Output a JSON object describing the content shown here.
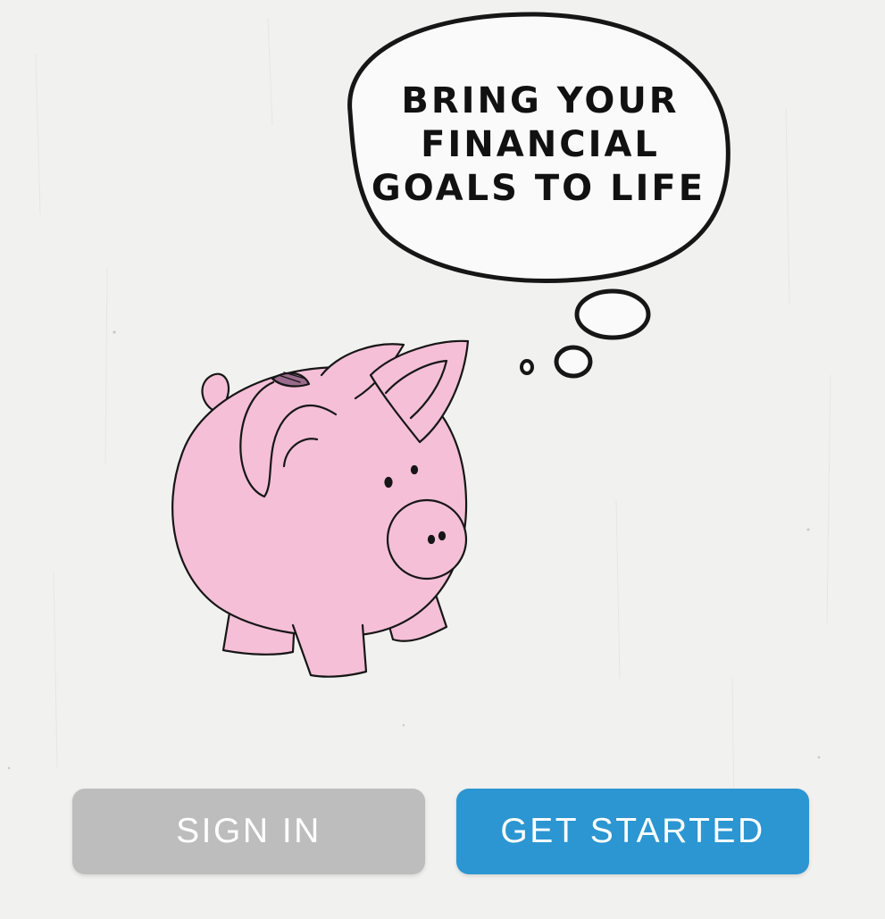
{
  "headline": {
    "line1": "BRING YOUR",
    "line2": "FINANCIAL",
    "line3": "GOALS TO LIFE"
  },
  "illustration": {
    "icon": "piggy-bank",
    "bubble_icon": "thought-bubble"
  },
  "buttons": {
    "sign_in": "SIGN IN",
    "get_started": "GET STARTED"
  },
  "colors": {
    "background": "#f1f1ef",
    "pig": "#f4bfd7",
    "sign_in": "#bdbdbd",
    "get_started": "#2b96d2",
    "button_text": "#ffffff"
  }
}
